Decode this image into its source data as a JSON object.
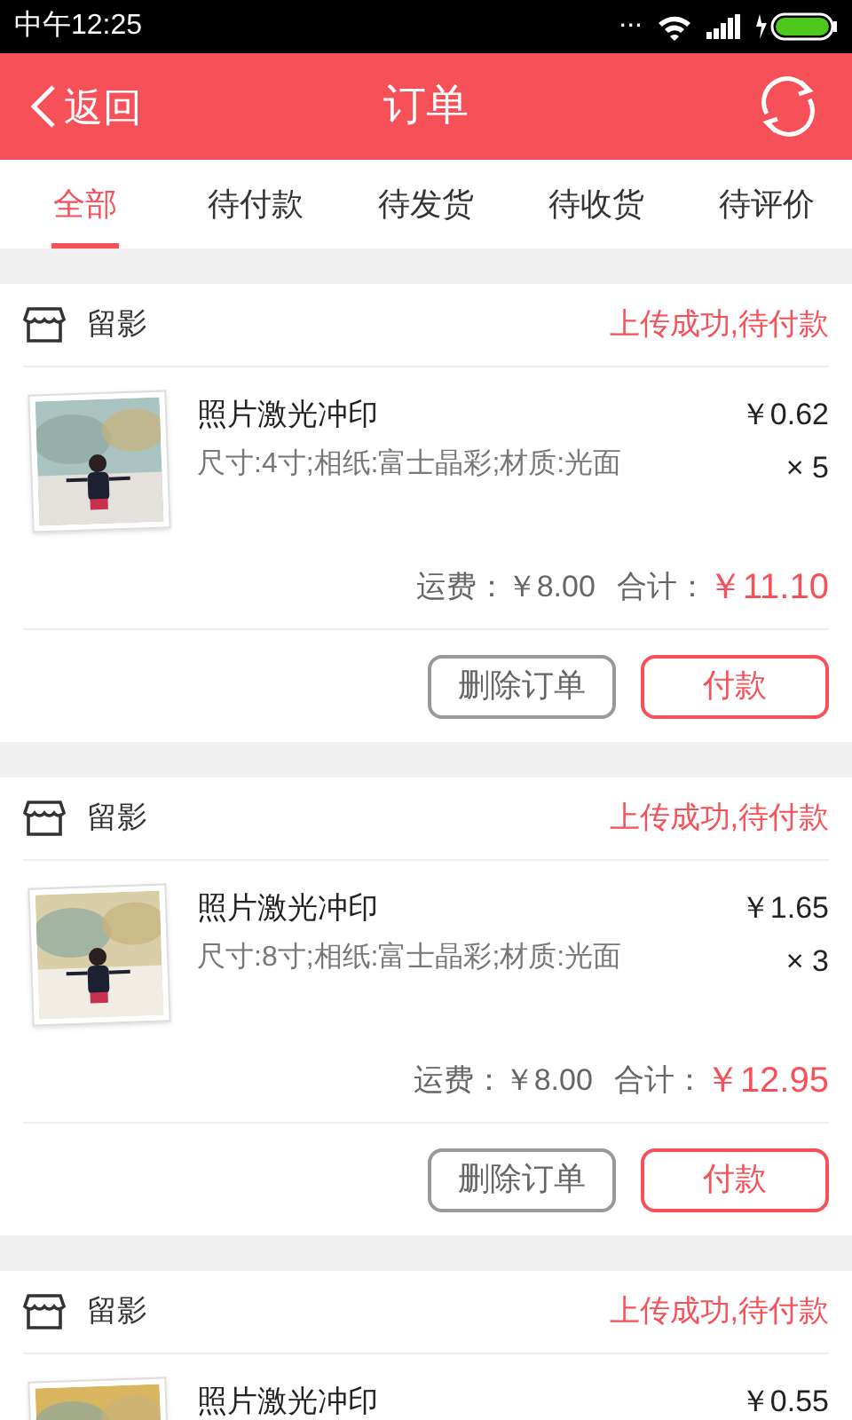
{
  "status_bar": {
    "time": "中午12:25",
    "dots": "..."
  },
  "header": {
    "back": "返回",
    "title": "订单"
  },
  "tabs": [
    {
      "label": "全部",
      "selected": true
    },
    {
      "label": "待付款",
      "selected": false
    },
    {
      "label": "待发货",
      "selected": false
    },
    {
      "label": "待收货",
      "selected": false
    },
    {
      "label": "待评价",
      "selected": false
    }
  ],
  "orders": [
    {
      "store": "留影",
      "status": "上传成功,待付款",
      "item": {
        "title": "照片激光冲印",
        "spec": "尺寸:4寸;相纸:富士晶彩;材质:光面",
        "price": "￥0.62",
        "qty": "× 5",
        "kind": "picture"
      },
      "shipping": "运费：￥8.00",
      "total_label": "合计：",
      "total": "￥11.10",
      "buttons": [
        "删除订单",
        "付款"
      ]
    },
    {
      "store": "留影",
      "status": "上传成功,待付款",
      "item": {
        "title": "照片激光冲印",
        "spec": "尺寸:8寸;相纸:富士晶彩;材质:光面",
        "price": "￥1.65",
        "qty": "× 3",
        "kind": "picture"
      },
      "shipping": "运费：￥8.00",
      "total_label": "合计：",
      "total": "￥12.95",
      "buttons": [
        "删除订单",
        "付款"
      ]
    },
    {
      "store": "留影",
      "status": "上传成功,待付款",
      "item": {
        "title": "照片激光冲印",
        "price": "￥0.55",
        "kind": "picture"
      }
    }
  ]
}
